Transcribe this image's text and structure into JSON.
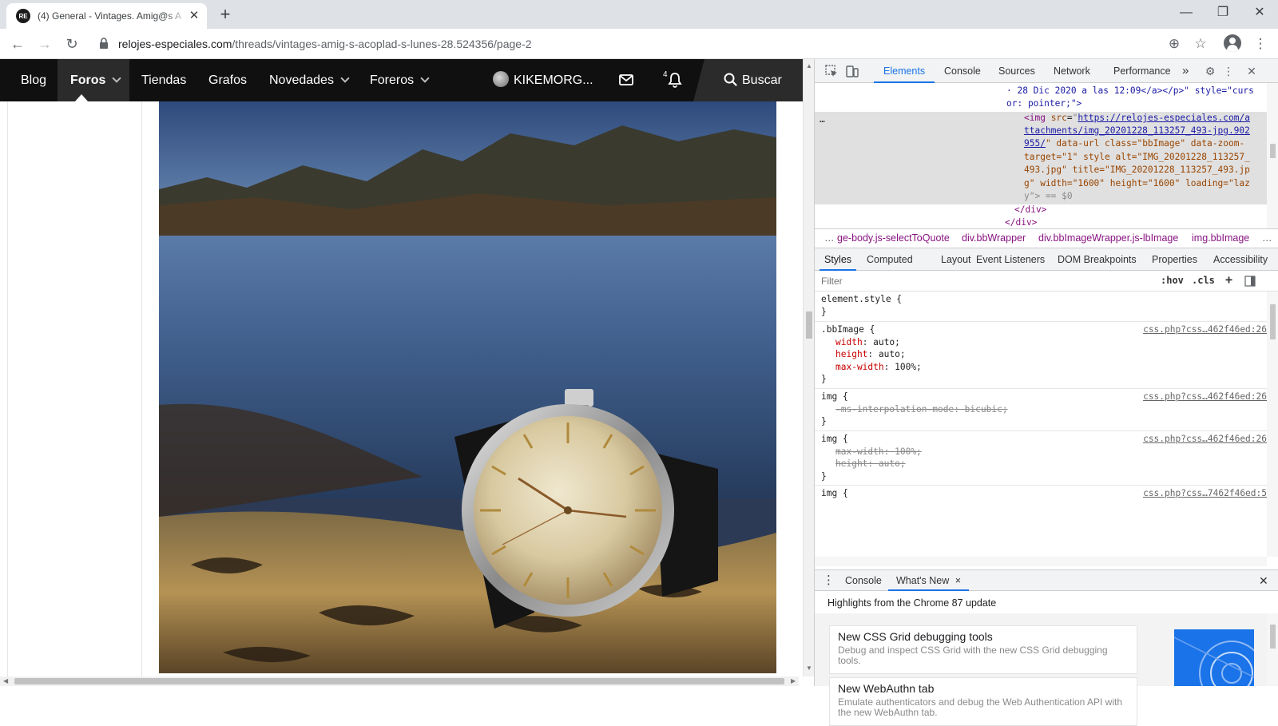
{
  "browser": {
    "tab_title": "(4) General - Vintages. Amig@s A",
    "favicon_text": "RE",
    "new_tab": "+",
    "url_domain": "relojes-especiales.com",
    "url_path": "/threads/vintages-amig-s-acoplad-s-lunes-28.524356/page-2"
  },
  "site_nav": {
    "items": [
      {
        "label": "Blog"
      },
      {
        "label": "Foros"
      },
      {
        "label": "Tiendas"
      },
      {
        "label": "Grafos"
      },
      {
        "label": "Novedades"
      },
      {
        "label": "Foreros"
      }
    ],
    "username": "KIKEMORG...",
    "notification_count": "4",
    "search_label": "Buscar"
  },
  "devtools": {
    "tabs": [
      "Elements",
      "Console",
      "Sources",
      "Network",
      "Performance"
    ],
    "more_tabs": "»",
    "elements": {
      "line1": "· 28 Dic 2020 a las 12:09</a></p>\" style=\"curs",
      "line2": "or: pointer;\">",
      "ellipsis": "…",
      "img_src_1": "https://relojes-especiales.com/a",
      "img_src_2": "ttachments/img_20201228_113257_493-jpg.902",
      "img_src_3": "955/",
      "img_rest_3": "\" data-url class=\"bbImage\" data-zoom-",
      "img_rest_4": "target=\"1\" style alt=\"IMG_20201228_113257_",
      "img_rest_5": "493.jpg\" title=\"IMG_20201228_113257_493.jp",
      "img_rest_6": "g\" width=\"1600\" height=\"1600\" loading=\"laz",
      "img_rest_7": "y\"> == $0",
      "close_div_1": "</div>",
      "close_div_2": "</div>"
    },
    "breadcrumbs": [
      "…",
      "ge-body.js-selectToQuote",
      "div.bbWrapper",
      "div.bbImageWrapper.js-lbImage",
      "img.bbImage",
      "…"
    ],
    "subtabs": [
      "Styles",
      "Computed",
      "Layout",
      "Event Listeners",
      "DOM Breakpoints",
      "Properties",
      "Accessibility"
    ],
    "filter_placeholder": "Filter",
    "hov": ":hov",
    "cls": ".cls",
    "plus": "+",
    "rules": [
      {
        "selector": "element.style {",
        "source": "",
        "decls": [],
        "close": "}"
      },
      {
        "selector": ".bbImage {",
        "source": "css.php?css…462f46ed:26",
        "decls": [
          {
            "p": "width",
            "v": "auto;"
          },
          {
            "p": "height",
            "v": "auto;"
          },
          {
            "p": "max-width",
            "v": "100%;"
          }
        ],
        "close": "}"
      },
      {
        "selector": "img {",
        "source": "css.php?css…462f46ed:26",
        "decls": [
          {
            "p": "-ms-interpolation-mode",
            "v": "bicubic;"
          }
        ],
        "close": "}"
      },
      {
        "selector": "img {",
        "source": "css.php?css…462f46ed:26",
        "decls": [
          {
            "p": "max-width",
            "v": "100%;"
          },
          {
            "p": "height",
            "v": "auto;"
          }
        ],
        "close": "}"
      },
      {
        "selector": "img {",
        "source": "css.php?css…7462f46ed:5",
        "decls": [],
        "close": ""
      }
    ],
    "drawer": {
      "tabs": [
        "Console",
        "What's New"
      ],
      "close_x": "×",
      "highlights": "Highlights from the Chrome 87 update",
      "cards": [
        {
          "title": "New CSS Grid debugging tools",
          "desc": "Debug and inspect CSS Grid with the new CSS Grid debugging tools."
        },
        {
          "title": "New WebAuthn tab",
          "desc": "Emulate authenticators and debug the Web Authentication API with the new WebAuthn tab."
        }
      ]
    }
  },
  "colors": {
    "accent": "#1a73e8",
    "site_nav_bg": "#101010",
    "tag": "#881280",
    "attr": "#994500"
  }
}
